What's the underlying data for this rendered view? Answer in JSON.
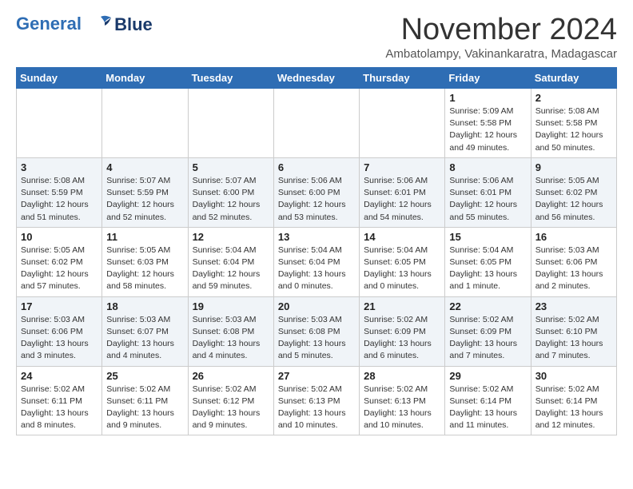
{
  "header": {
    "logo_line1": "General",
    "logo_line2": "Blue",
    "title": "November 2024",
    "subtitle": "Ambatolampy, Vakinankaratra, Madagascar"
  },
  "columns": [
    "Sunday",
    "Monday",
    "Tuesday",
    "Wednesday",
    "Thursday",
    "Friday",
    "Saturday"
  ],
  "weeks": [
    [
      {
        "day": "",
        "info": ""
      },
      {
        "day": "",
        "info": ""
      },
      {
        "day": "",
        "info": ""
      },
      {
        "day": "",
        "info": ""
      },
      {
        "day": "",
        "info": ""
      },
      {
        "day": "1",
        "info": "Sunrise: 5:09 AM\nSunset: 5:58 PM\nDaylight: 12 hours\nand 49 minutes."
      },
      {
        "day": "2",
        "info": "Sunrise: 5:08 AM\nSunset: 5:58 PM\nDaylight: 12 hours\nand 50 minutes."
      }
    ],
    [
      {
        "day": "3",
        "info": "Sunrise: 5:08 AM\nSunset: 5:59 PM\nDaylight: 12 hours\nand 51 minutes."
      },
      {
        "day": "4",
        "info": "Sunrise: 5:07 AM\nSunset: 5:59 PM\nDaylight: 12 hours\nand 52 minutes."
      },
      {
        "day": "5",
        "info": "Sunrise: 5:07 AM\nSunset: 6:00 PM\nDaylight: 12 hours\nand 52 minutes."
      },
      {
        "day": "6",
        "info": "Sunrise: 5:06 AM\nSunset: 6:00 PM\nDaylight: 12 hours\nand 53 minutes."
      },
      {
        "day": "7",
        "info": "Sunrise: 5:06 AM\nSunset: 6:01 PM\nDaylight: 12 hours\nand 54 minutes."
      },
      {
        "day": "8",
        "info": "Sunrise: 5:06 AM\nSunset: 6:01 PM\nDaylight: 12 hours\nand 55 minutes."
      },
      {
        "day": "9",
        "info": "Sunrise: 5:05 AM\nSunset: 6:02 PM\nDaylight: 12 hours\nand 56 minutes."
      }
    ],
    [
      {
        "day": "10",
        "info": "Sunrise: 5:05 AM\nSunset: 6:02 PM\nDaylight: 12 hours\nand 57 minutes."
      },
      {
        "day": "11",
        "info": "Sunrise: 5:05 AM\nSunset: 6:03 PM\nDaylight: 12 hours\nand 58 minutes."
      },
      {
        "day": "12",
        "info": "Sunrise: 5:04 AM\nSunset: 6:04 PM\nDaylight: 12 hours\nand 59 minutes."
      },
      {
        "day": "13",
        "info": "Sunrise: 5:04 AM\nSunset: 6:04 PM\nDaylight: 13 hours\nand 0 minutes."
      },
      {
        "day": "14",
        "info": "Sunrise: 5:04 AM\nSunset: 6:05 PM\nDaylight: 13 hours\nand 0 minutes."
      },
      {
        "day": "15",
        "info": "Sunrise: 5:04 AM\nSunset: 6:05 PM\nDaylight: 13 hours\nand 1 minute."
      },
      {
        "day": "16",
        "info": "Sunrise: 5:03 AM\nSunset: 6:06 PM\nDaylight: 13 hours\nand 2 minutes."
      }
    ],
    [
      {
        "day": "17",
        "info": "Sunrise: 5:03 AM\nSunset: 6:06 PM\nDaylight: 13 hours\nand 3 minutes."
      },
      {
        "day": "18",
        "info": "Sunrise: 5:03 AM\nSunset: 6:07 PM\nDaylight: 13 hours\nand 4 minutes."
      },
      {
        "day": "19",
        "info": "Sunrise: 5:03 AM\nSunset: 6:08 PM\nDaylight: 13 hours\nand 4 minutes."
      },
      {
        "day": "20",
        "info": "Sunrise: 5:03 AM\nSunset: 6:08 PM\nDaylight: 13 hours\nand 5 minutes."
      },
      {
        "day": "21",
        "info": "Sunrise: 5:02 AM\nSunset: 6:09 PM\nDaylight: 13 hours\nand 6 minutes."
      },
      {
        "day": "22",
        "info": "Sunrise: 5:02 AM\nSunset: 6:09 PM\nDaylight: 13 hours\nand 7 minutes."
      },
      {
        "day": "23",
        "info": "Sunrise: 5:02 AM\nSunset: 6:10 PM\nDaylight: 13 hours\nand 7 minutes."
      }
    ],
    [
      {
        "day": "24",
        "info": "Sunrise: 5:02 AM\nSunset: 6:11 PM\nDaylight: 13 hours\nand 8 minutes."
      },
      {
        "day": "25",
        "info": "Sunrise: 5:02 AM\nSunset: 6:11 PM\nDaylight: 13 hours\nand 9 minutes."
      },
      {
        "day": "26",
        "info": "Sunrise: 5:02 AM\nSunset: 6:12 PM\nDaylight: 13 hours\nand 9 minutes."
      },
      {
        "day": "27",
        "info": "Sunrise: 5:02 AM\nSunset: 6:13 PM\nDaylight: 13 hours\nand 10 minutes."
      },
      {
        "day": "28",
        "info": "Sunrise: 5:02 AM\nSunset: 6:13 PM\nDaylight: 13 hours\nand 10 minutes."
      },
      {
        "day": "29",
        "info": "Sunrise: 5:02 AM\nSunset: 6:14 PM\nDaylight: 13 hours\nand 11 minutes."
      },
      {
        "day": "30",
        "info": "Sunrise: 5:02 AM\nSunset: 6:14 PM\nDaylight: 13 hours\nand 12 minutes."
      }
    ]
  ]
}
